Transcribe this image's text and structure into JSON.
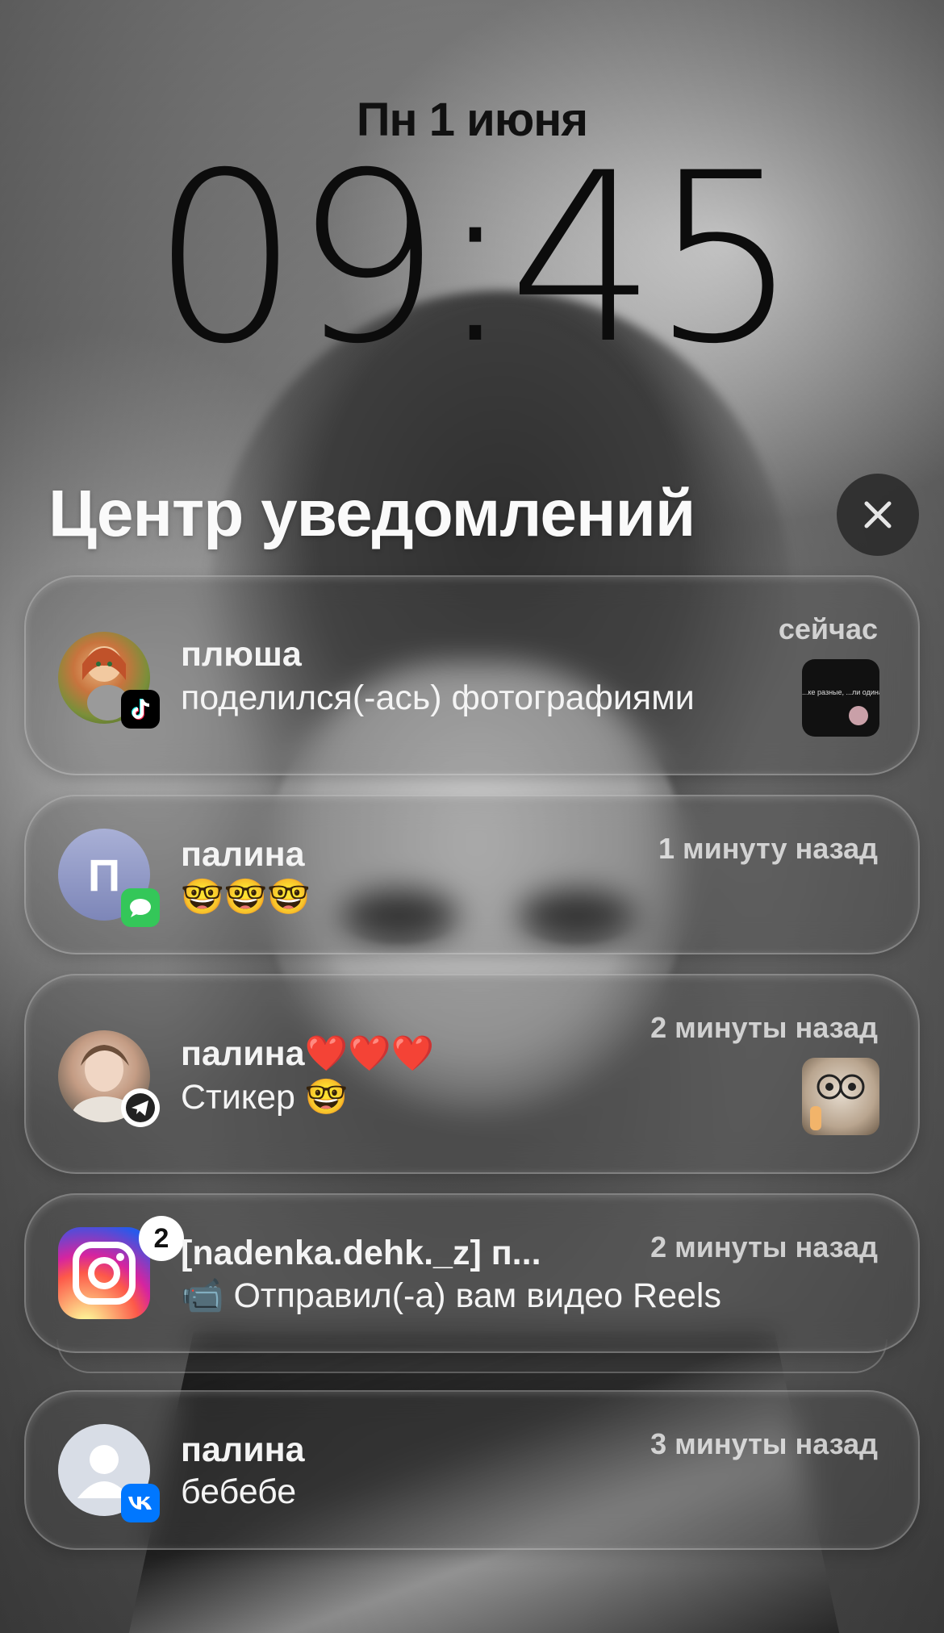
{
  "lockscreen": {
    "date": "Пн 1 июня",
    "time": "09:45"
  },
  "notification_center": {
    "title": "Центр уведомлений",
    "close_icon": "close-icon"
  },
  "notifications": [
    {
      "app": "TikTok",
      "app_icon": "tiktok-icon",
      "sender": "плюша",
      "message": "поделился(-ась) фотографиями",
      "time": "сейчас",
      "thumbnail_text": "...ке разные, ...ли одинаково"
    },
    {
      "app": "Messages",
      "app_icon": "messages-icon",
      "avatar_letter": "П",
      "sender": "палина",
      "message": "🤓🤓🤓",
      "time": "1 минуту назад"
    },
    {
      "app": "Telegram",
      "app_icon": "telegram-icon",
      "sender": "палина❤️❤️❤️",
      "message": "Стикер 🤓",
      "time": "2 минуты назад"
    },
    {
      "app": "Instagram",
      "app_icon": "instagram-icon",
      "badge_count": "2",
      "sender": "[nadenka.dehk._z] п...",
      "message": "📹 Отправил(-а) вам видео Reels",
      "time": "2 минуты назад"
    },
    {
      "app": "VK",
      "app_icon": "vk-icon",
      "sender": "палина",
      "message": "бебебе",
      "time": "3 минуты назад"
    }
  ],
  "colors": {
    "card_bg": "#50505047",
    "text": "#f4f4f4",
    "messages_green": "#34c759",
    "telegram_blue": "#2aa1da",
    "vk_blue": "#0077ff"
  }
}
